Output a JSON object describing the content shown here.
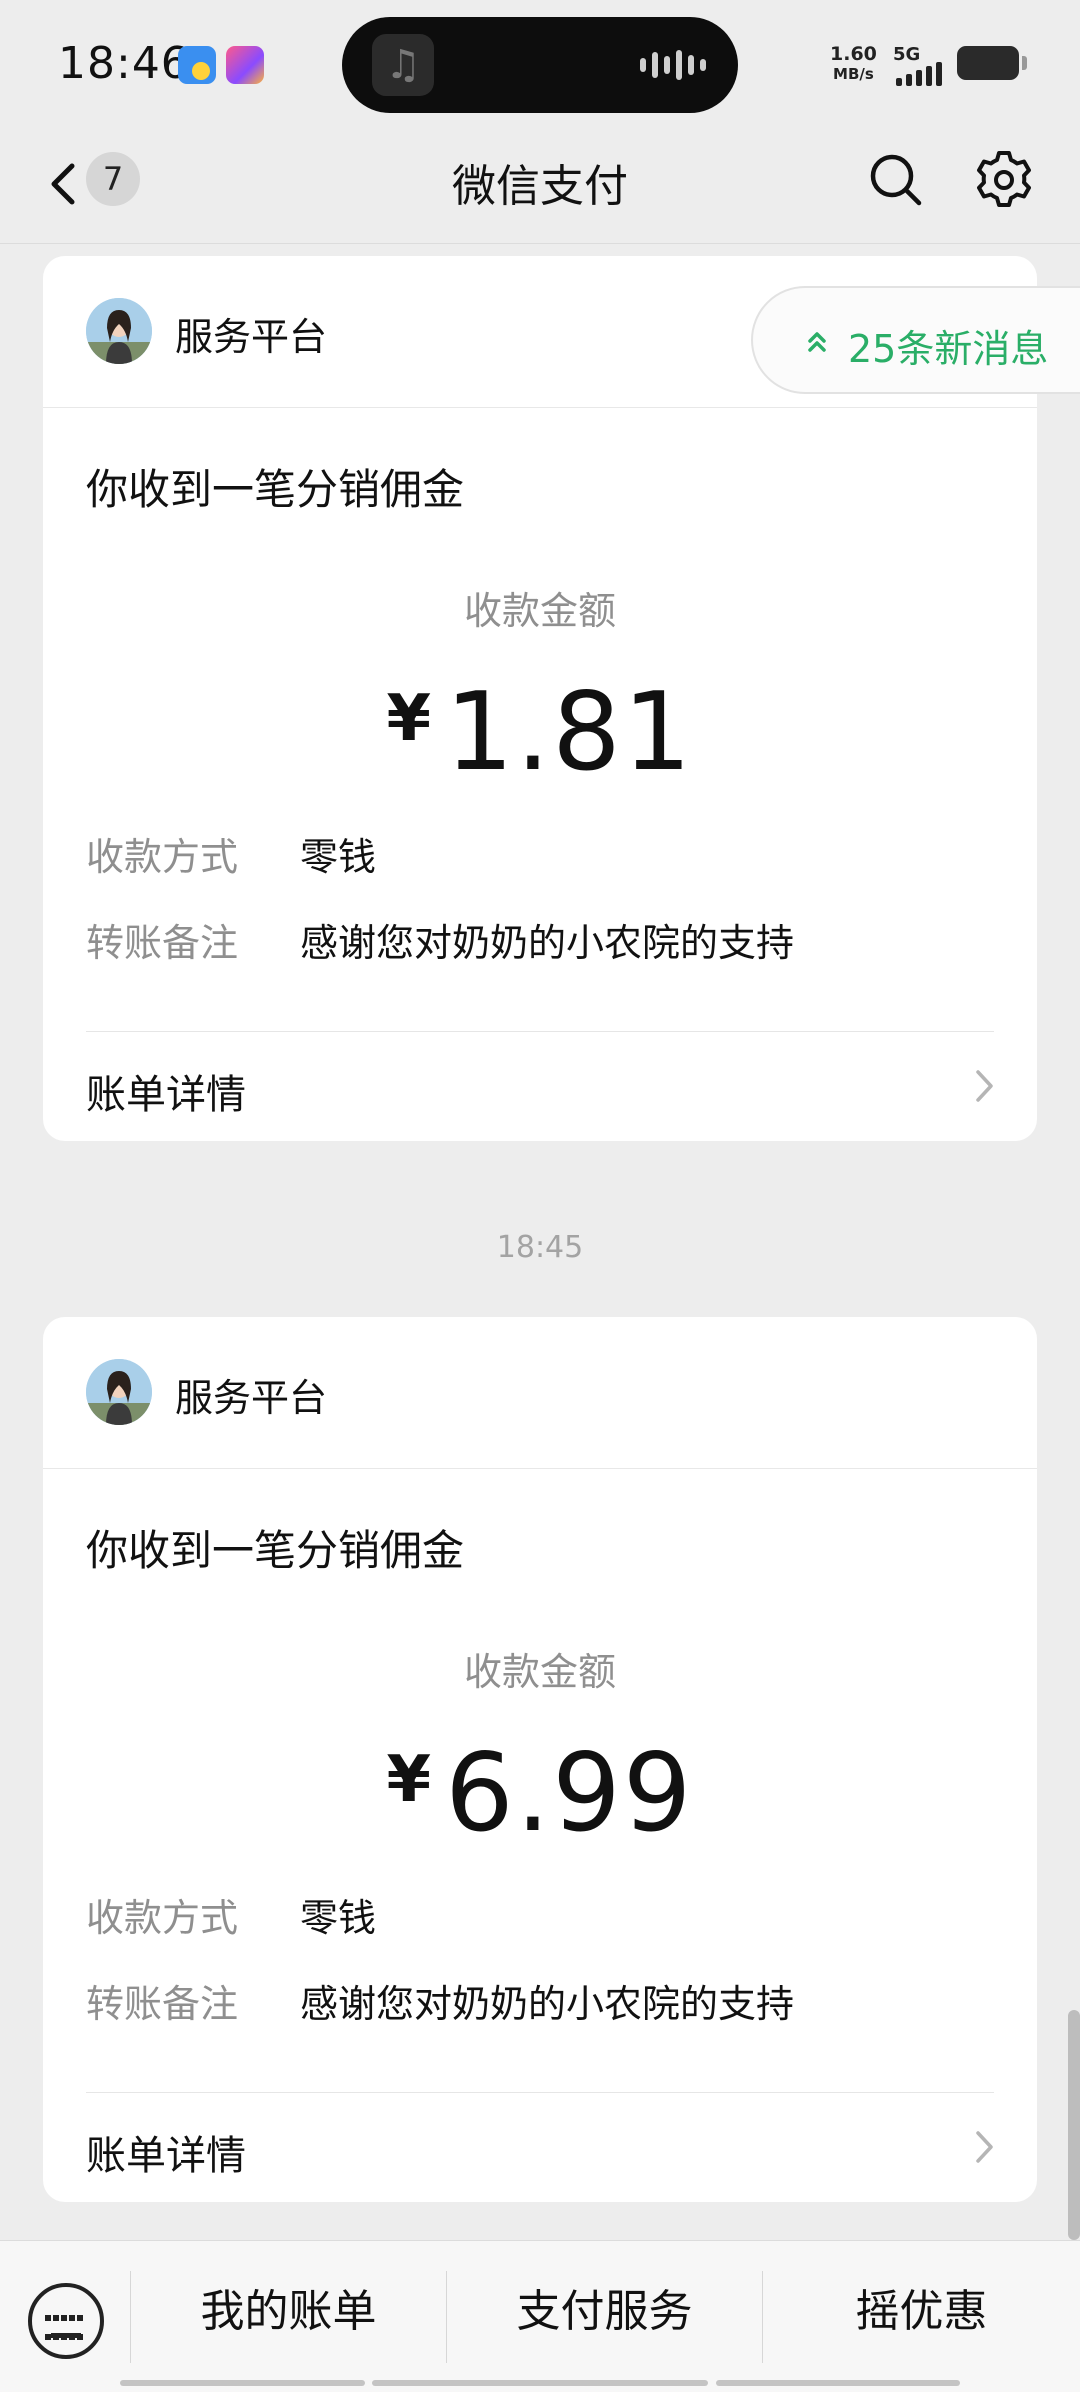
{
  "status_bar": {
    "time": "18:46",
    "speed_value": "1.60",
    "speed_unit": "MB/s",
    "network": "5G"
  },
  "nav": {
    "back_badge": "7",
    "title": "微信支付",
    "icons": [
      "back-arrow-icon",
      "search-icon",
      "gear-icon"
    ]
  },
  "new_messages": {
    "label": "25条新消息",
    "color": "#2aae67"
  },
  "cards": [
    {
      "sender": "服务平台",
      "title": "你收到一笔分销佣金",
      "amount_label": "收款金额",
      "currency": "¥",
      "amount": "1.81",
      "method_key": "收款方式",
      "method_value": "零钱",
      "note_key": "转账备注",
      "note_value": "感谢您对奶奶的小农院的支持",
      "detail_label": "账单详情"
    },
    {
      "sender": "服务平台",
      "title": "你收到一笔分销佣金",
      "amount_label": "收款金额",
      "currency": "¥",
      "amount": "6.99",
      "method_key": "收款方式",
      "method_value": "零钱",
      "note_key": "转账备注",
      "note_value": "感谢您对奶奶的小农院的支持",
      "detail_label": "账单详情"
    }
  ],
  "timestamp": "18:45",
  "bottom_bar": {
    "tabs": [
      "我的账单",
      "支付服务",
      "摇优惠"
    ]
  }
}
